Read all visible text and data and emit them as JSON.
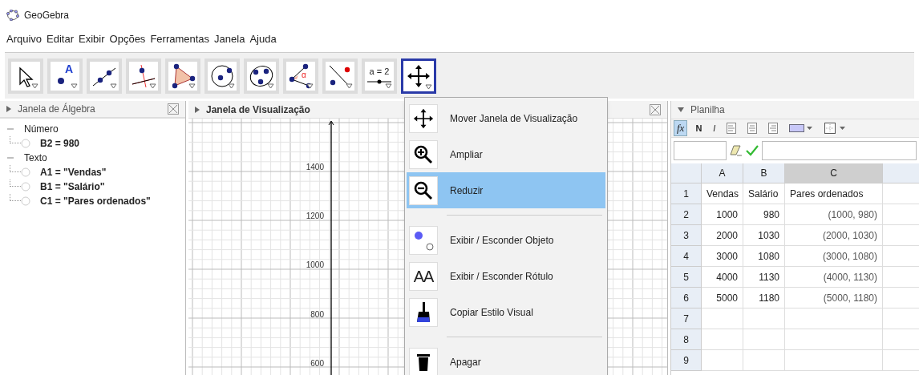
{
  "window": {
    "title": "GeoGebra"
  },
  "menu": [
    "Arquivo",
    "Editar",
    "Exibir",
    "Opções",
    "Ferramentas",
    "Janela",
    "Ajuda"
  ],
  "tools": [
    {
      "kind": "move",
      "selected": false
    },
    {
      "kind": "point",
      "label": "A",
      "selected": false
    },
    {
      "kind": "line",
      "selected": false
    },
    {
      "kind": "perpendicular",
      "selected": false
    },
    {
      "kind": "polygon",
      "selected": false
    },
    {
      "kind": "circle",
      "selected": false
    },
    {
      "kind": "conic",
      "selected": false
    },
    {
      "kind": "angle",
      "label": "α",
      "selected": false
    },
    {
      "kind": "reflect",
      "selected": false
    },
    {
      "kind": "slider",
      "label": "a = 2",
      "selected": false
    },
    {
      "kind": "pan",
      "selected": true
    }
  ],
  "algebra": {
    "title": "Janela de Álgebra",
    "groups": [
      {
        "label": "Número",
        "expanded": true,
        "children": [
          {
            "label": "B2 = 980"
          }
        ]
      },
      {
        "label": "Texto",
        "expanded": true,
        "children": [
          {
            "label": "A1 = \"Vendas\""
          },
          {
            "label": "B1 = \"Salário\""
          },
          {
            "label": "C1 = \"Pares ordenados\""
          }
        ]
      }
    ]
  },
  "graphics": {
    "title": "Janela de Visualização",
    "y_labels": [
      "1400",
      "1200",
      "1000",
      "800",
      "600"
    ]
  },
  "tool_menu": [
    {
      "kind": "pan",
      "label": "Mover Janela de Visualização",
      "selected": false,
      "separator_before": false
    },
    {
      "kind": "zoom_in",
      "label": "Ampliar",
      "selected": false,
      "separator_before": false
    },
    {
      "kind": "zoom_out",
      "label": "Reduzir",
      "selected": true,
      "separator_before": false
    },
    {
      "kind": "show_object",
      "label": "Exibir / Esconder Objeto",
      "selected": false,
      "separator_before": true
    },
    {
      "kind": "show_label",
      "label": "Exibir / Esconder Rótulo",
      "icon_text": "AA",
      "selected": false,
      "separator_before": false
    },
    {
      "kind": "copy_style",
      "label": "Copiar Estilo Visual",
      "selected": false,
      "separator_before": false
    },
    {
      "kind": "delete",
      "label": "Apagar",
      "selected": false,
      "separator_before": true
    }
  ],
  "spreadsheet": {
    "title": "Planilha",
    "toolbar": [
      {
        "kind": "fx",
        "label": "fx",
        "selected": true
      },
      {
        "kind": "bold",
        "label": "N",
        "selected": false
      },
      {
        "kind": "italic",
        "label": "I",
        "selected": false
      },
      {
        "kind": "align_left",
        "selected": false
      },
      {
        "kind": "align_center",
        "selected": false
      },
      {
        "kind": "align_right",
        "selected": false
      },
      {
        "kind": "bg_color",
        "selected": false
      },
      {
        "kind": "border",
        "selected": false
      }
    ],
    "columns": [
      {
        "label": "A",
        "selected": false
      },
      {
        "label": "B",
        "selected": false
      },
      {
        "label": "C",
        "selected": true
      }
    ],
    "rows": [
      {
        "label": "1",
        "cells": [
          "Vendas",
          "Salário",
          "Pares ordenados"
        ]
      },
      {
        "label": "2",
        "cells": [
          "1000",
          "980",
          "(1000, 980)"
        ]
      },
      {
        "label": "3",
        "cells": [
          "2000",
          "1030",
          "(2000, 1030)"
        ]
      },
      {
        "label": "4",
        "cells": [
          "3000",
          "1080",
          "(3000, 1080)"
        ]
      },
      {
        "label": "5",
        "cells": [
          "4000",
          "1130",
          "(4000, 1130)"
        ]
      },
      {
        "label": "6",
        "cells": [
          "5000",
          "1180",
          "(5000, 1180)"
        ]
      },
      {
        "label": "7",
        "cells": []
      },
      {
        "label": "8",
        "cells": []
      },
      {
        "label": "9",
        "cells": []
      }
    ]
  }
}
